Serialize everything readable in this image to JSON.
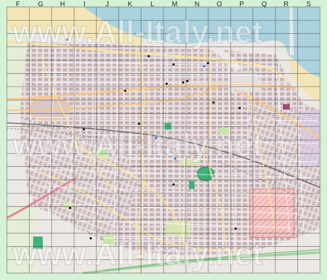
{
  "map": {
    "columns": [
      "F",
      "G",
      "H",
      "I",
      "J",
      "K",
      "L",
      "M",
      "N",
      "O",
      "P",
      "Q",
      "R",
      "S"
    ],
    "rows": [
      "1",
      "2",
      "3",
      "4",
      "5",
      "6",
      "7",
      "8",
      "9",
      "10",
      "11",
      "12",
      "13",
      "14",
      "15",
      "16",
      "17",
      "18",
      "19",
      "20"
    ],
    "watermarks": [
      "www.All-Italy.net",
      "www.All-Italy.net",
      "www.All-Italy.net"
    ],
    "colors": {
      "sea": "#aad3df",
      "beach": "#f3e5b5",
      "urban": "#e6dfe0",
      "block": "#c9b3b7",
      "park": "#c7e7a5",
      "sport": "#3fb37b",
      "main_road": "#f7c98b",
      "highway": "#e6879a",
      "grid": "#4a4a4a",
      "frame": "#d6f2d6"
    }
  }
}
